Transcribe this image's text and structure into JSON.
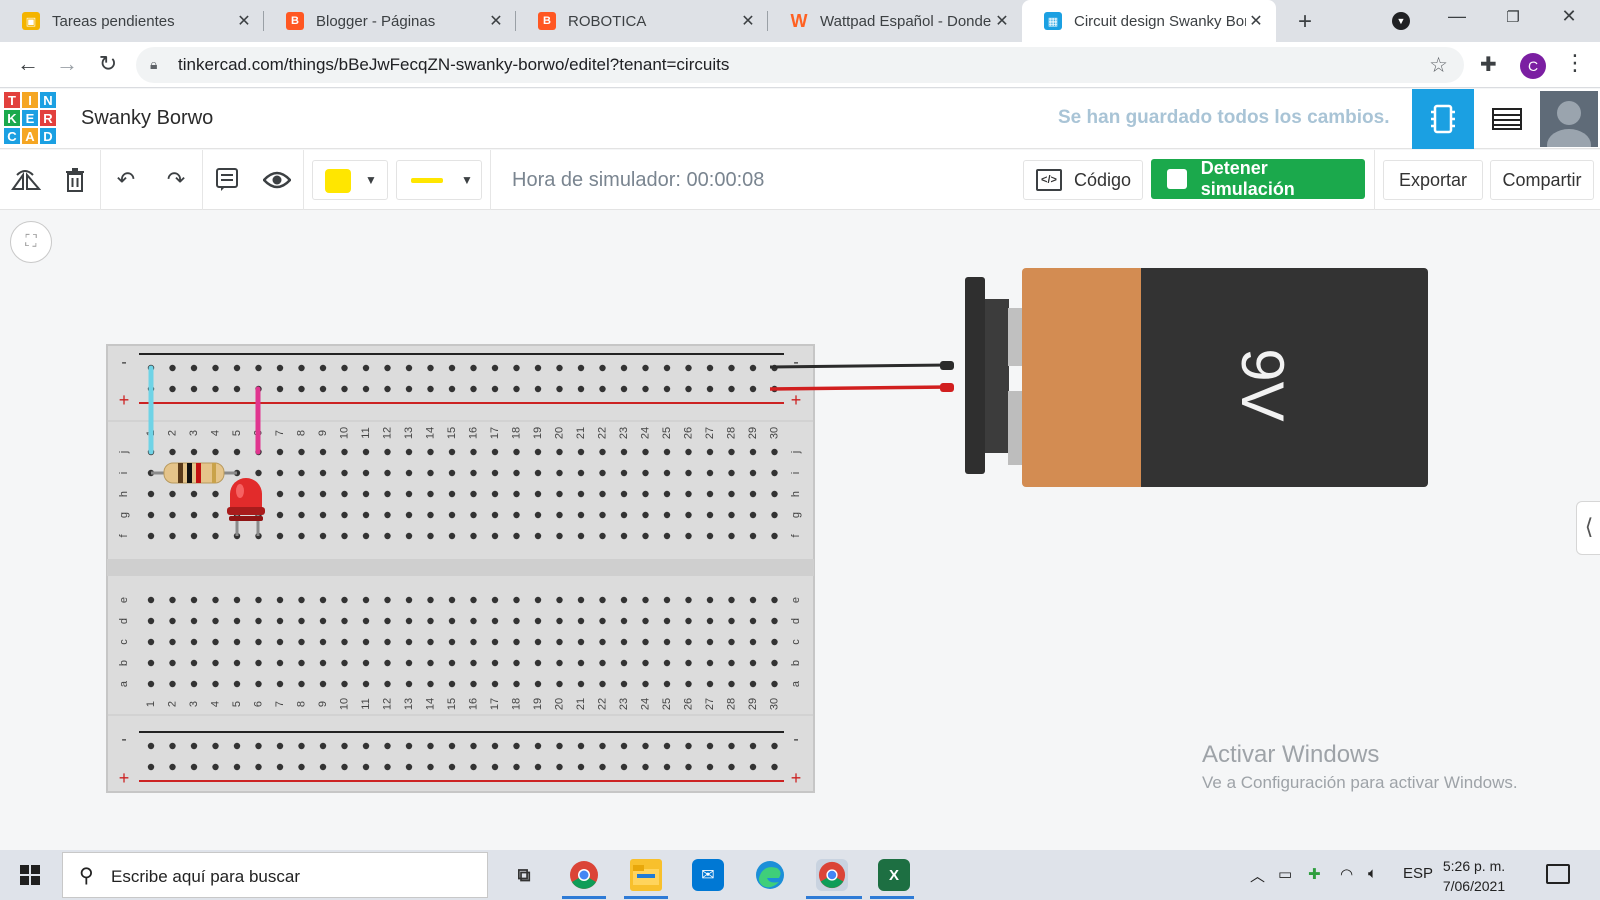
{
  "browser": {
    "tabs": [
      {
        "title": "Tareas pendientes",
        "favicon": "classroom-icon",
        "color": "#f4b400"
      },
      {
        "title": "Blogger - Páginas",
        "favicon": "blogger-icon",
        "color": "#ff5722"
      },
      {
        "title": "ROBOTICA",
        "favicon": "blogger-icon",
        "color": "#ff5722"
      },
      {
        "title": "Wattpad Español - Donde",
        "favicon": "wattpad-icon",
        "color": "#ff6122"
      },
      {
        "title": "Circuit design Swanky Bor",
        "favicon": "tinkercad-icon",
        "color": "#1ba0e2"
      }
    ],
    "url": "tinkercad.com/things/bBeJwFecqZN-swanky-borwo/editel?tenant=circuits",
    "profile_initial": "C"
  },
  "header": {
    "logo_letters": [
      "T",
      "I",
      "N",
      "K",
      "E",
      "R",
      "C",
      "A",
      "D"
    ],
    "logo_colors": [
      "#e2403d",
      "#f5a623",
      "#1ba0e2",
      "#1ba94c",
      "#1ba0e2",
      "#e2403d",
      "#1ba0e2",
      "#f5a623",
      "#1ba0e2"
    ],
    "design_title": "Swanky Borwo",
    "saved_status": "Se han guardado todos los cambios."
  },
  "toolbar": {
    "sim_time": "Hora de simulador: 00:00:08",
    "code_label": "Código",
    "stop_sim_label": "Detener simulación",
    "export_label": "Exportar",
    "share_label": "Compartir",
    "selected_color": "#ffe600"
  },
  "canvas": {
    "battery_label": "9V",
    "breadboard_columns": 30,
    "top_row_letters": [
      "j",
      "i",
      "h",
      "g",
      "f"
    ],
    "bottom_row_letters": [
      "e",
      "d",
      "c",
      "b",
      "a"
    ],
    "rail_minus": "-",
    "rail_plus": "+",
    "windows_notice_title": "Activar Windows",
    "windows_notice_sub": "Ve a Configuración para activar Windows."
  },
  "taskbar": {
    "search_placeholder": "Escribe aquí para buscar",
    "language": "ESP",
    "time": "5:26 p. m.",
    "date": "7/06/2021"
  },
  "colors": {
    "accent": "#1ba0e2",
    "sim_green": "#1ba94c",
    "rail_red": "#cc2222",
    "battery_orange": "#d38c52",
    "battery_body": "#333333"
  }
}
